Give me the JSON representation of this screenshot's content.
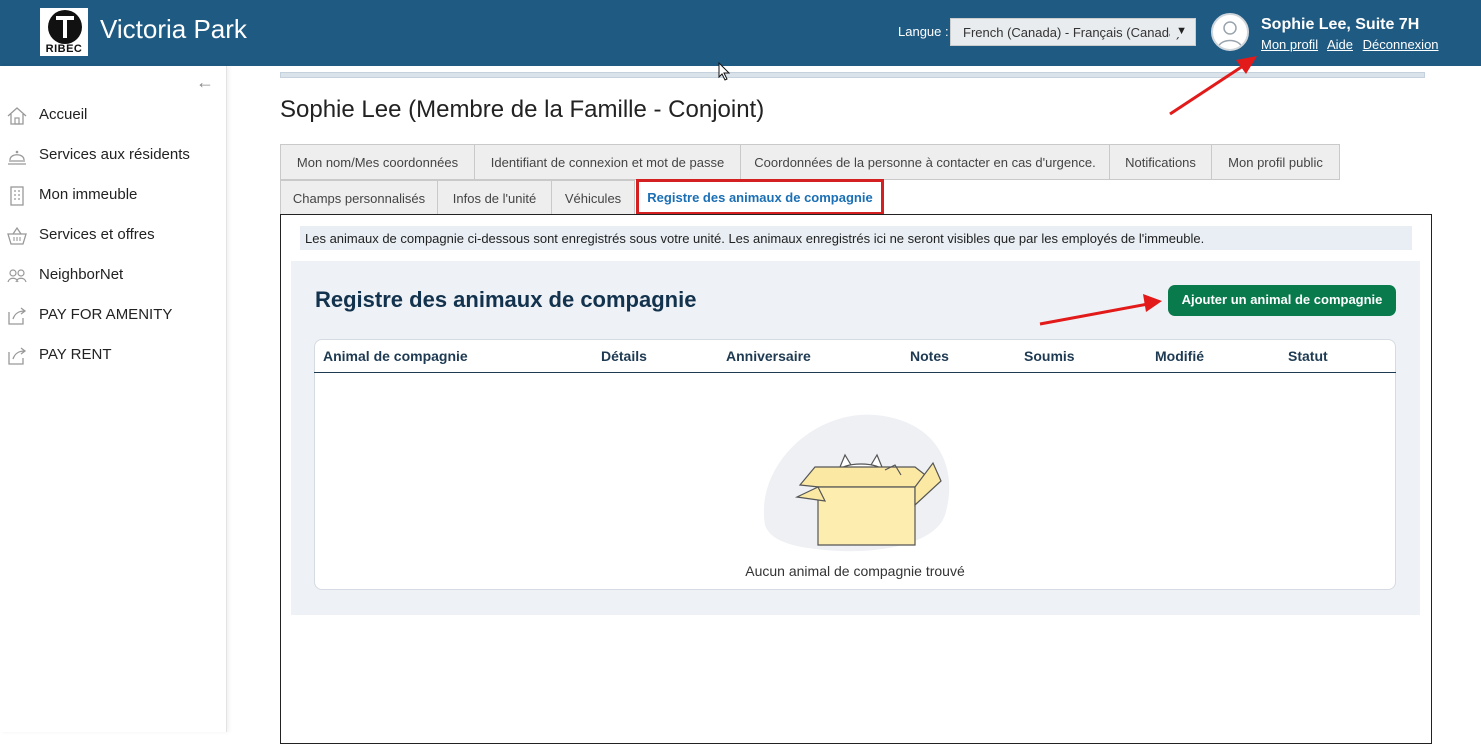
{
  "header": {
    "site_title": "Victoria Park",
    "logo_text": "RIBEC",
    "language_label": "Langue :",
    "language_value": "French (Canada) - Français (Canada)",
    "user_name": "Sophie Lee, Suite 7H",
    "links": {
      "profile": "Mon profil",
      "help": "Aide",
      "logout": "Déconnexion"
    }
  },
  "sidebar": {
    "items": [
      {
        "label": "Accueil",
        "icon": "home-icon"
      },
      {
        "label": "Services aux résidents",
        "icon": "concierge-bell-icon"
      },
      {
        "label": "Mon immeuble",
        "icon": "building-icon"
      },
      {
        "label": "Services et offres",
        "icon": "basket-icon"
      },
      {
        "label": "NeighborNet",
        "icon": "people-icon"
      },
      {
        "label": "PAY FOR AMENITY",
        "icon": "external-link-icon"
      },
      {
        "label": "PAY RENT",
        "icon": "external-link-icon"
      }
    ]
  },
  "page": {
    "title": "Sophie Lee (Membre de la Famille - Conjoint)",
    "tabs_row1": [
      "Mon nom/Mes coordonnées",
      "Identifiant de connexion et mot de passe",
      "Coordonnées de la personne à contacter en cas d'urgence.",
      "Notifications",
      "Mon profil public"
    ],
    "tabs_row2": [
      "Champs personnalisés",
      "Infos de l'unité",
      "Véhicules",
      "Registre des animaux de compagnie"
    ],
    "info_text": "Les animaux de compagnie ci-dessous sont enregistrés sous votre unité. Les animaux enregistrés ici ne seront visibles que par les employés de l'immeuble.",
    "card_title": "Registre des animaux de compagnie",
    "add_button": "Ajouter un animal de compagnie",
    "columns": [
      "Animal de compagnie",
      "Détails",
      "Anniversaire",
      "Notes",
      "Soumis",
      "Modifié",
      "Statut"
    ],
    "empty_message": "Aucun animal de compagnie trouvé"
  },
  "colors": {
    "header_bg": "#1e5a82",
    "accent_green": "#087a4c",
    "annotation_red": "#d42020",
    "active_tab_text": "#1a6fb5"
  }
}
